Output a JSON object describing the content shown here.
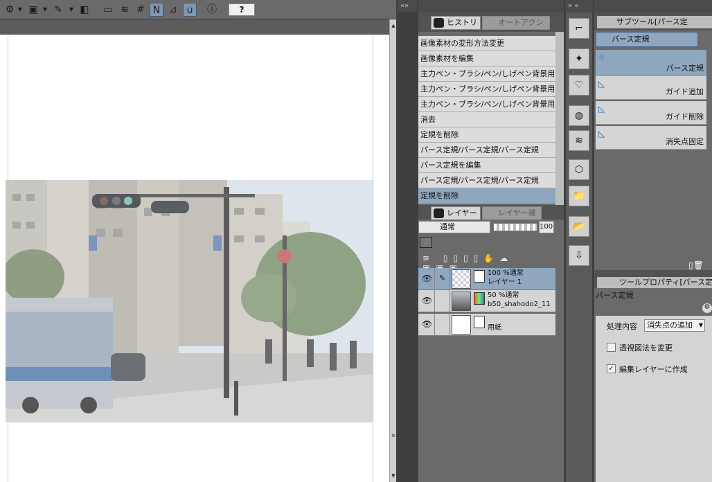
{
  "history": {
    "tab_active": "ヒストリー",
    "tab_inactive": "オートアクション",
    "items": [
      {
        "label": "画像素材の変形方法変更"
      },
      {
        "label": "画像素材を編集"
      },
      {
        "label": "主力ペン・ブラシ/ペン/しげペン背景用"
      },
      {
        "label": "主力ペン・ブラシ/ペン/しげペン背景用"
      },
      {
        "label": "主力ペン・ブラシ/ペン/しげペン背景用"
      },
      {
        "label": "消去"
      },
      {
        "label": "定規を削除"
      },
      {
        "label": "パース定規/パース定規/パース定規"
      },
      {
        "label": "パース定規を編集"
      },
      {
        "label": "パース定規/パース定規/パース定規"
      },
      {
        "label": "定規を削除"
      }
    ]
  },
  "layers": {
    "tab_active": "レイヤー",
    "tab_inactive": "レイヤー検索",
    "blend_mode": "通常",
    "opacity": "100",
    "items": [
      {
        "line1": "100 %通常",
        "line2": "レイヤー 1"
      },
      {
        "line1": "50 %通常",
        "line2": "b50_shahodo2_11"
      },
      {
        "line1": "",
        "line2": "用紙"
      }
    ]
  },
  "subtool": {
    "title": "サブツール[パース定",
    "group": "パース定規",
    "items": [
      {
        "label": "パース定規"
      },
      {
        "label": "ガイド追加"
      },
      {
        "label": "ガイド削除"
      },
      {
        "label": "消失点固定"
      }
    ]
  },
  "toolprop": {
    "title": "ツールプロパティ[パース定",
    "tool_name": "パース定規",
    "process_label": "処理内容",
    "process_value": "消失点の追加",
    "cb1_label": "透視図法を変更",
    "cb2_label": "編集レイヤーに作成"
  },
  "toolbar": {
    "help": "?"
  },
  "colors": {
    "accent": "#8fa8bf",
    "panel_bg": "#6a6a6a"
  }
}
